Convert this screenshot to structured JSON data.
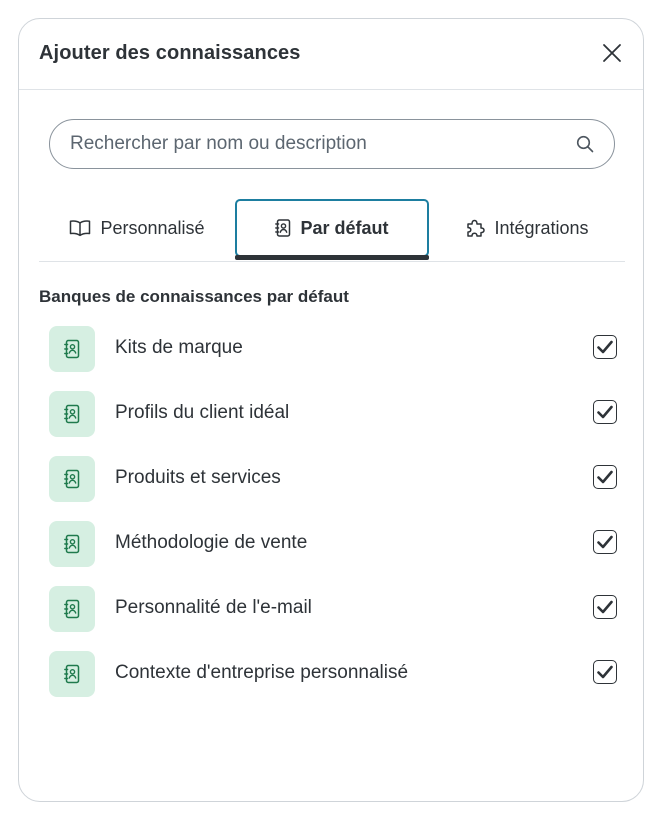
{
  "modal": {
    "title": "Ajouter des connaissances"
  },
  "search": {
    "placeholder": "Rechercher par nom ou description",
    "value": ""
  },
  "tabs": [
    {
      "label": "Personnalisé",
      "icon": "book-open-icon",
      "selected": false
    },
    {
      "label": "Par défaut",
      "icon": "contact-book-icon",
      "selected": true
    },
    {
      "label": "Intégrations",
      "icon": "puzzle-icon",
      "selected": false
    }
  ],
  "section": {
    "title": "Banques de connaissances par défaut"
  },
  "knowledge_bases": [
    {
      "label": "Kits de marque",
      "icon": "contact-book-icon",
      "checked": true
    },
    {
      "label": "Profils du client idéal",
      "icon": "contact-book-icon",
      "checked": true
    },
    {
      "label": "Produits et services",
      "icon": "contact-book-icon",
      "checked": true
    },
    {
      "label": "Méthodologie de vente",
      "icon": "contact-book-icon",
      "checked": true
    },
    {
      "label": "Personnalité de l'e-mail",
      "icon": "contact-book-icon",
      "checked": true
    },
    {
      "label": "Contexte d'entreprise personnalisé",
      "icon": "contact-book-icon",
      "checked": true
    }
  ],
  "colors": {
    "text": "#2e3338",
    "icon_bg": "#d6efe2",
    "icon_fg": "#1f7a4d",
    "tab_focus": "#1d7ea0",
    "border": "#cfd4d9"
  }
}
